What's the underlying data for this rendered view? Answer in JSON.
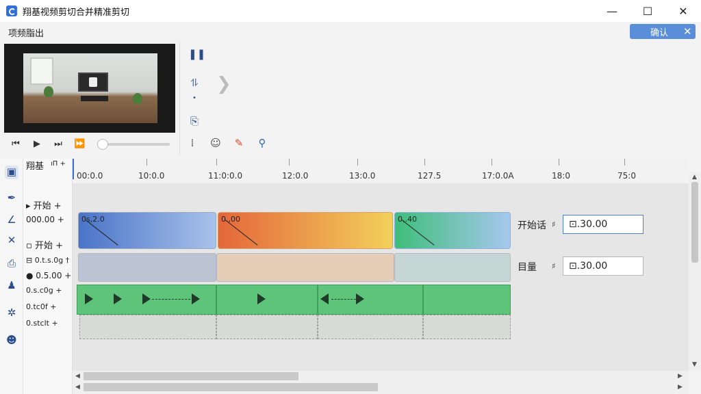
{
  "window": {
    "title": "翔基视频剪切合并精准剪切",
    "minimize": "—",
    "maximize": "☐",
    "close": "✕"
  },
  "menu": {
    "label": "项频脂出"
  },
  "confirm": {
    "label": "确认",
    "close": "✕"
  },
  "player": {
    "prev": "⏮",
    "play": "▶",
    "next": "⏭",
    "fast_forward": "⏩"
  },
  "track_header": {
    "top_label": "翔基",
    "top_suffix": "ıΠ +",
    "rows": [
      {
        "text": "▸ 开始 +"
      },
      {
        "text": "000.00 +"
      },
      {
        "text": "▫ 开始 +"
      },
      {
        "text": "⊟ 0.t.s.0g †"
      },
      {
        "text": "● 0.5.00 +"
      },
      {
        "text": "0.s.c0g +"
      },
      {
        "text": "0.tc0f +"
      },
      {
        "text": "0.stclt +"
      }
    ]
  },
  "ruler": {
    "labels": [
      "00:0.0",
      "10:0.0",
      "11:0:0.0",
      "12:0.0",
      "13:0.0",
      "127.5",
      "17:0.0A",
      "18:0",
      "75:0"
    ]
  },
  "clips": [
    {
      "label": "0s,2.0",
      "color_from": "#4a74c8",
      "color_to": "#a9c2ea"
    },
    {
      "label": "0.,00",
      "color_from": "#e4673a",
      "color_to": "#f2d05a"
    },
    {
      "label": "0,.40",
      "color_from": "#3fbe7a",
      "color_to": "#a6c8ee"
    }
  ],
  "side_fields": [
    {
      "label": "开始话",
      "hash": "♯",
      "value": "⊡.30.00"
    },
    {
      "label": "目量",
      "hash": "♯",
      "value": "⊡.30.00"
    }
  ]
}
